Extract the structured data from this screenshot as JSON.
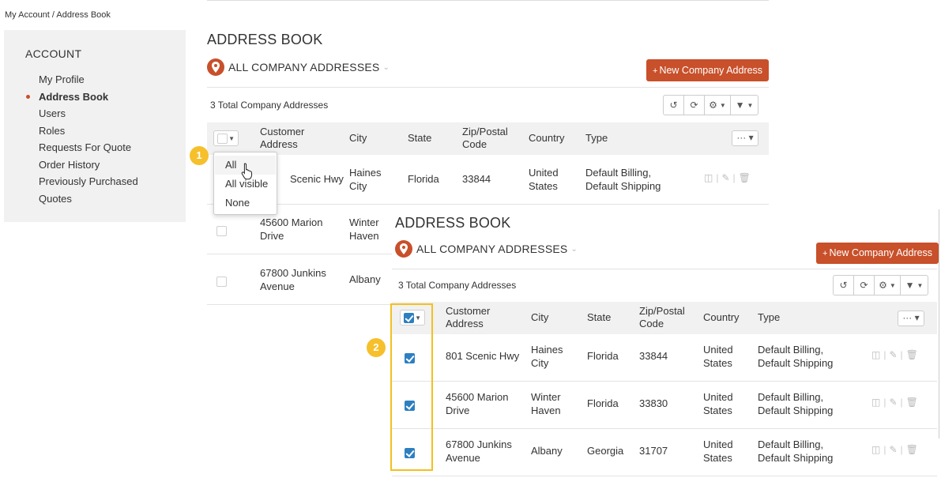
{
  "breadcrumb": "My Account / Address Book",
  "sidebar": {
    "title": "ACCOUNT",
    "items": [
      {
        "label": "My Profile",
        "active": false
      },
      {
        "label": "Address Book",
        "active": true
      },
      {
        "label": "Users",
        "active": false
      },
      {
        "label": "Roles",
        "active": false
      },
      {
        "label": "Requests For Quote",
        "active": false
      },
      {
        "label": "Order History",
        "active": false
      },
      {
        "label": "Previously Purchased",
        "active": false
      },
      {
        "label": "Quotes",
        "active": false
      }
    ]
  },
  "address_book": {
    "title": "ADDRESS BOOK",
    "location_filter": "ALL COMPANY ADDRESSES",
    "new_button": "New Company Address",
    "new_button_plus": "+",
    "total": "3 Total Company Addresses",
    "more_label": "···",
    "columns": [
      "Customer Address",
      "City",
      "State",
      "Zip/Postal Code",
      "Country",
      "Type"
    ],
    "rows": [
      {
        "address": "801 Scenic Hwy",
        "city": "Haines City",
        "state": "Florida",
        "zip": "33844",
        "country": "United States",
        "type": "Default Billing, Default Shipping"
      },
      {
        "address": "45600 Marion Drive",
        "city": "Winter Haven",
        "state": "Florida",
        "zip": "33830",
        "country": "United States",
        "type": "Default Billing, Default Shipping"
      },
      {
        "address": "67800 Junkins Avenue",
        "city": "Albany",
        "state": "Georgia",
        "zip": "31707",
        "country": "United States",
        "type": "Default Billing, Default Shipping"
      }
    ],
    "partial_row1_address": "Scenic Hwy"
  },
  "select_menu": {
    "options": [
      "All",
      "All visible",
      "None"
    ],
    "highlighted": "All"
  },
  "steps": [
    "1",
    "2"
  ],
  "colors": {
    "accent": "#c8502a",
    "check": "#2d7fc1",
    "callout": "#f6c02c"
  },
  "icons": [
    "location-pin-icon",
    "undo-icon",
    "refresh-icon",
    "gear-icon",
    "filter-icon",
    "map-icon",
    "pencil-icon",
    "trash-icon",
    "hand-cursor-icon"
  ]
}
